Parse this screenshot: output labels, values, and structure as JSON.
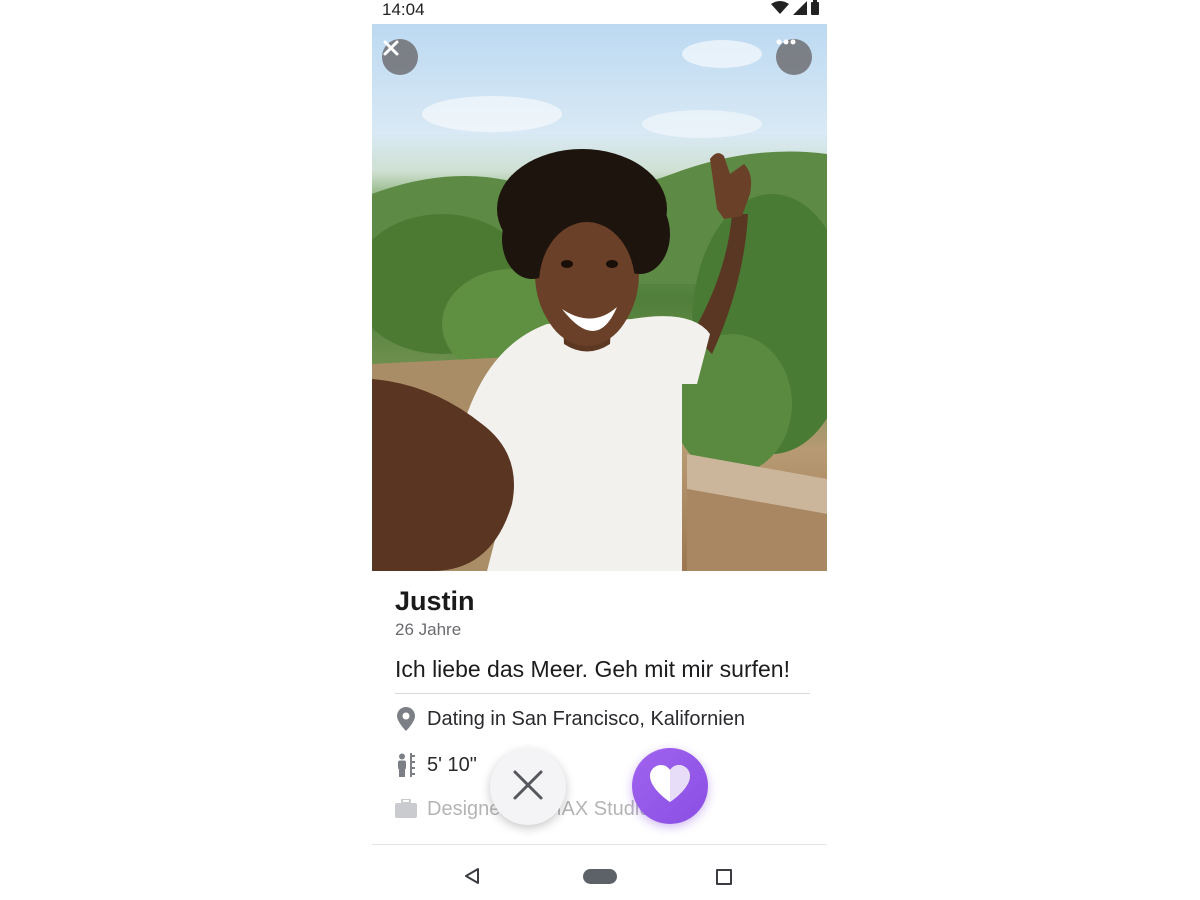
{
  "status_bar": {
    "time": "14:04"
  },
  "profile": {
    "name": "Justin",
    "age": "26 Jahre",
    "bio": "Ich liebe das Meer. Geh mit mir surfen!",
    "details": [
      {
        "icon": "location-pin-icon",
        "text": "Dating in San Francisco, Kalifornien"
      },
      {
        "icon": "height-icon",
        "text": "5' 10\""
      },
      {
        "icon": "briefcase-icon",
        "text": "Designer bei MAX Studio"
      }
    ]
  },
  "colors": {
    "accent": "#8f55e8",
    "text": "#1c1c1e",
    "muted": "#6b6b70"
  }
}
